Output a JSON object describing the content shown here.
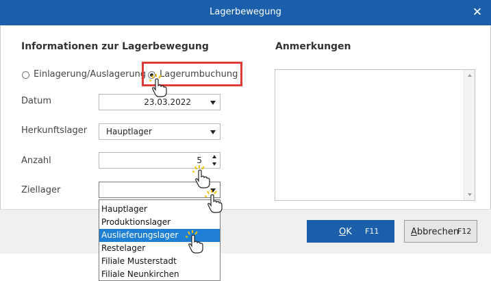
{
  "window": {
    "title": "Lagerbewegung",
    "close_label": "✕"
  },
  "left": {
    "heading": "Informationen zur Lagerbewegung",
    "radio_options": [
      {
        "label": "Einlagerung/Auslagerung",
        "checked": false
      },
      {
        "label": "Lagerumbuchung",
        "checked": true
      }
    ],
    "fields": {
      "datum": {
        "label": "Datum",
        "value": "23.03.2022"
      },
      "herkunftslager": {
        "label": "Herkunftslager",
        "value": "Hauptlager"
      },
      "anzahl": {
        "label": "Anzahl",
        "value": "5"
      },
      "ziellager": {
        "label": "Ziellager",
        "value": ""
      }
    }
  },
  "right": {
    "heading": "Anmerkungen",
    "notes_value": ""
  },
  "dropdown": {
    "options": [
      "Hauptlager",
      "Produktionslager",
      "Auslieferungslager",
      "Restelager",
      "Filiale Musterstadt",
      "Filiale Neunkirchen"
    ],
    "selected": "Auslieferungslager"
  },
  "buttons": {
    "ok": {
      "label_underlined": "O",
      "label_rest": "K",
      "shortcut": "F11"
    },
    "cancel": {
      "label_underlined": "A",
      "label_rest": "bbrechen",
      "shortcut": "F12"
    }
  },
  "colors": {
    "titlebar": "#1b5faa",
    "highlight": "#e03a3a",
    "selection": "#1f7fd4"
  },
  "icons": [
    "close-icon",
    "dropdown-arrow-icon",
    "spin-up-icon",
    "spin-down-icon",
    "pointer-hand-icon"
  ]
}
